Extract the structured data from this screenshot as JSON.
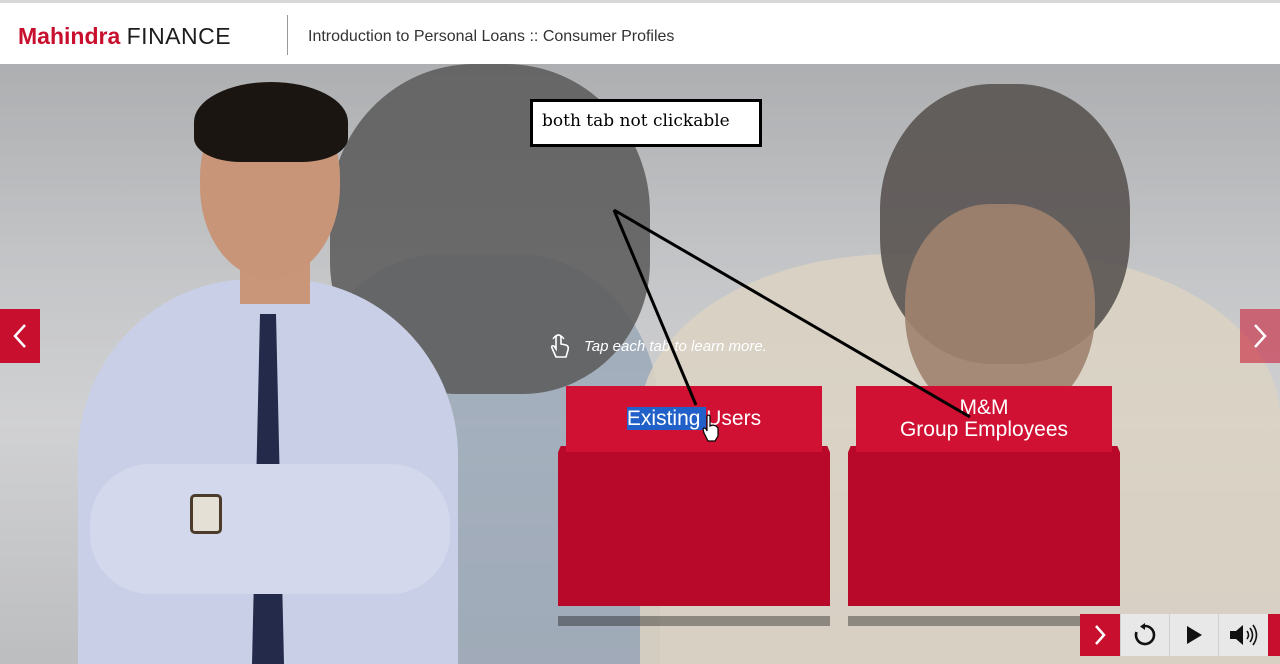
{
  "header": {
    "logo_brand": "Mahindra",
    "logo_suffix": "FINANCE",
    "course_title": "Introduction to Personal Loans :: Consumer Profiles"
  },
  "nav": {
    "prev_icon": "chevron-left-icon",
    "next_icon": "chevron-right-icon"
  },
  "instruction": {
    "icon": "tap-hand-icon",
    "text": "Tap each tab to learn more."
  },
  "tabs": [
    {
      "label_highlighted": "Existing ",
      "label_rest": "Users"
    },
    {
      "label_line1": "M&M",
      "label_line2": "Group Employees"
    }
  ],
  "annotation": {
    "text": "both tab not clickable"
  },
  "controls": {
    "next_icon": "chevron-right-icon",
    "replay_icon": "replay-icon",
    "play_icon": "play-icon",
    "volume_icon": "volume-icon"
  },
  "colors": {
    "brand_red": "#c8102e",
    "tab_red": "#d01134",
    "tab_dark_red": "#b8092a",
    "selection_blue": "#2060c8"
  }
}
